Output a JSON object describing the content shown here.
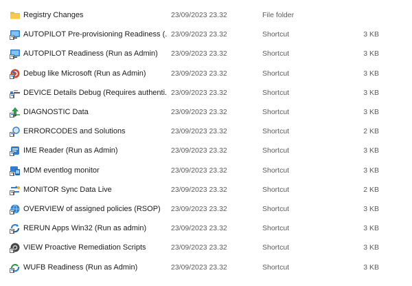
{
  "colors": {
    "folder": "#f4c542",
    "shortcut_blue": "#2b7fd4",
    "text_secondary": "#5b5b5b"
  },
  "files": [
    {
      "name": "Registry Changes",
      "date": "23/09/2023 23.32",
      "type": "File folder",
      "size": "",
      "icon": "folder-icon"
    },
    {
      "name": "AUTOPILOT Pre-provisioning Readiness (...",
      "date": "23/09/2023 23.32",
      "type": "Shortcut",
      "size": "3 KB",
      "icon": "autopilot-shortcut-icon"
    },
    {
      "name": "AUTOPILOT Readiness (Run as Admin)",
      "date": "23/09/2023 23.32",
      "type": "Shortcut",
      "size": "3 KB",
      "icon": "autopilot-shortcut-icon"
    },
    {
      "name": "Debug like Microsoft (Run as Admin)",
      "date": "23/09/2023 23.32",
      "type": "Shortcut",
      "size": "3 KB",
      "icon": "debug-shortcut-icon"
    },
    {
      "name": "DEVICE Details Debug (Requires authenti...",
      "date": "23/09/2023 23.32",
      "type": "Shortcut",
      "size": "3 KB",
      "icon": "device-shortcut-icon"
    },
    {
      "name": "DIAGNOSTIC Data",
      "date": "23/09/2023 23.32",
      "type": "Shortcut",
      "size": "3 KB",
      "icon": "diagnostic-shortcut-icon"
    },
    {
      "name": "ERRORCODES and Solutions",
      "date": "23/09/2023 23.32",
      "type": "Shortcut",
      "size": "2 KB",
      "icon": "search-shortcut-icon"
    },
    {
      "name": "IME Reader (Run as Admin)",
      "date": "23/09/2023 23.32",
      "type": "Shortcut",
      "size": "3 KB",
      "icon": "ime-shortcut-icon"
    },
    {
      "name": "MDM eventlog monitor",
      "date": "23/09/2023 23.32",
      "type": "Shortcut",
      "size": "3 KB",
      "icon": "mdm-shortcut-icon"
    },
    {
      "name": "MONITOR Sync Data Live",
      "date": "23/09/2023 23.32",
      "type": "Shortcut",
      "size": "2 KB",
      "icon": "monitor-shortcut-icon"
    },
    {
      "name": "OVERVIEW of assigned policies (RSOP)",
      "date": "23/09/2023 23.32",
      "type": "Shortcut",
      "size": "3 KB",
      "icon": "overview-shortcut-icon"
    },
    {
      "name": "RERUN Apps Win32 (Run as admin)",
      "date": "23/09/2023 23.32",
      "type": "Shortcut",
      "size": "3 KB",
      "icon": "rerun-shortcut-icon"
    },
    {
      "name": "VIEW Proactive Remediation Scripts",
      "date": "23/09/2023 23.32",
      "type": "Shortcut",
      "size": "3 KB",
      "icon": "view-shortcut-icon"
    },
    {
      "name": "WUFB Readiness (Run as Admin)",
      "date": "23/09/2023 23.32",
      "type": "Shortcut",
      "size": "3 KB",
      "icon": "wufb-shortcut-icon"
    }
  ]
}
